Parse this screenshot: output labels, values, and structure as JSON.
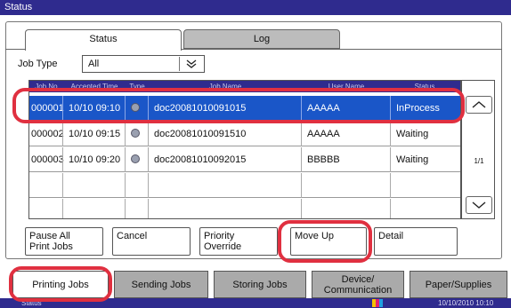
{
  "window": {
    "title": "Status"
  },
  "tabs": [
    {
      "label": "Status"
    },
    {
      "label": "Log"
    }
  ],
  "filter": {
    "label": "Job Type",
    "value": "All"
  },
  "table": {
    "headers": [
      "Job No.",
      "Accepted Time",
      "Type",
      "Job Name",
      "User Name",
      "Status"
    ],
    "rows": [
      {
        "job_no": "000001",
        "time": "10/10 09:10",
        "job_name": "doc20081010091015",
        "user": "AAAAA",
        "status": "InProcess"
      },
      {
        "job_no": "000002",
        "time": "10/10 09:15",
        "job_name": "doc20081010091510",
        "user": "AAAAA",
        "status": "Waiting"
      },
      {
        "job_no": "000003",
        "time": "10/10 09:20",
        "job_name": "doc20081010092015",
        "user": "BBBBB",
        "status": "Waiting"
      }
    ]
  },
  "pager": {
    "page": "1/1"
  },
  "actions": {
    "pause_all_line1": "Pause All",
    "pause_all_line2": "Print Jobs",
    "cancel": "Cancel",
    "priority_line1": "Priority",
    "priority_line2": "Override",
    "move_up": "Move Up",
    "detail": "Detail"
  },
  "bottom_tabs": {
    "printing": "Printing Jobs",
    "sending": "Sending Jobs",
    "storing": "Storing Jobs",
    "device_line1": "Device/",
    "device_line2": "Communication",
    "paper": "Paper/Supplies"
  },
  "statusbar": {
    "label": "Status",
    "datetime": "10/10/2010 10:10"
  },
  "colors": {
    "title_bar": "#2f2b8e",
    "selected_row": "#1a56c8",
    "highlight_ring": "#e03040"
  }
}
